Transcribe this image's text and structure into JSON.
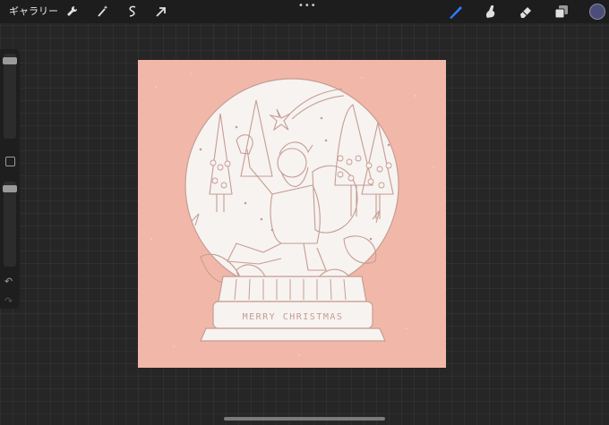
{
  "topbar": {
    "gallery_label": "ギャラリー",
    "tools_left": [
      "wrench-icon",
      "magic-wand-icon",
      "selection-icon",
      "transform-arrow-icon"
    ],
    "more_label": "•••",
    "tools_right": [
      "brush-icon",
      "smudge-icon",
      "eraser-icon",
      "layers-icon",
      "color-icon"
    ],
    "active_color": "#4a4e78",
    "accent_color": "#2f7bff"
  },
  "sidebar": {
    "brush_size": 0.95,
    "opacity": 0.95
  },
  "artwork": {
    "banner_text": "MERRY CHRISTMAS",
    "background_color": "#f1b8aa",
    "line_color": "#c59d92"
  }
}
